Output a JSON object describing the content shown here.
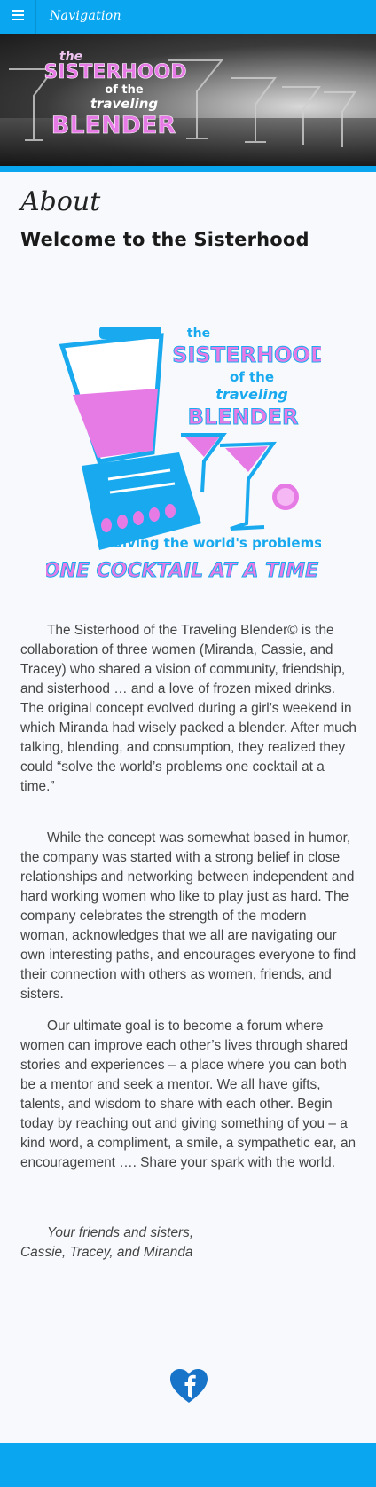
{
  "nav": {
    "label": "Navigation"
  },
  "hero": {
    "logo_lines": [
      "the",
      "SISTERHOOD",
      "of the",
      "traveling",
      "BLENDER"
    ]
  },
  "main": {
    "heading": "About",
    "subheading": "Welcome to the Sisterhood",
    "logo": {
      "line_the": "the",
      "line_sisterhood": "SISTERHOOD",
      "line_ofthe": "of the",
      "line_traveling": "traveling",
      "line_blender": "BLENDER",
      "tagline1": "Solving the world's problems",
      "tagline2": "ONE COCKTAIL AT A TIME"
    },
    "paragraphs": [
      "The Sisterhood of the Traveling Blender© is the collaboration of three women (Miranda, Cassie, and Tracey) who shared a vision of community, friendship, and sisterhood … and a love of frozen mixed drinks. The original concept evolved during a girl’s weekend in which Miranda had wisely packed a blender. After much talking, blending, and consumption, they realized they could “solve the world’s problems one cocktail at a time.”",
      "While the concept was somewhat based in humor, the company was started with a strong belief in close relationships and networking between independent and hard working women who like to play just as hard. The company celebrates the strength of the modern woman, acknowledges that we all are navigating our own interesting paths, and encourages everyone to find their connection with others as women, friends, and sisters.",
      "Our ultimate goal is to become a forum where women can improve each other’s lives through shared stories and experiences – a place where you can both be a mentor and seek a mentor. We all have gifts, talents, and wisdom to share with each other. Begin today by reaching out and giving something of you – a kind word, a compliment, a smile, a sympathetic ear, an encouragement …. Share your spark with the world."
    ],
    "signature": {
      "line1": "Your friends and sisters,",
      "line2": "Cassie, Tracey, and Miranda"
    }
  },
  "colors": {
    "brand": "#0aa6ef",
    "pink": "#e77be6",
    "blue": "#18a9ee"
  },
  "icons": {
    "menu": "hamburger-icon",
    "social": "facebook-heart-icon"
  }
}
